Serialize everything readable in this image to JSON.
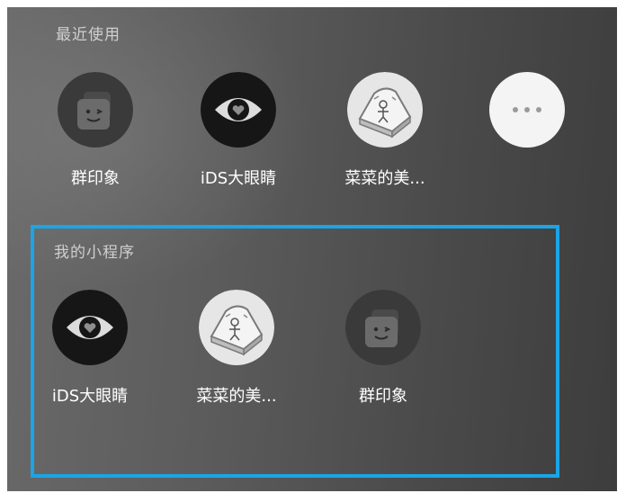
{
  "recent": {
    "title": "最近使用",
    "apps": [
      {
        "label": "群印象",
        "icon": "cube-face-icon"
      },
      {
        "label": "iDS大眼睛",
        "icon": "eye-icon"
      },
      {
        "label": "菜菜的美...",
        "icon": "bread-icon"
      }
    ],
    "more_icon": "more-dots-icon"
  },
  "my_programs": {
    "title": "我的小程序",
    "apps": [
      {
        "label": "iDS大眼睛",
        "icon": "eye-icon"
      },
      {
        "label": "菜菜的美...",
        "icon": "bread-icon"
      },
      {
        "label": "群印象",
        "icon": "cube-face-icon"
      }
    ]
  },
  "colors": {
    "highlight_border": "#1aa5e6",
    "panel_background": "#5a5a5a",
    "label_text": "#ffffff",
    "section_title_text": "#cfcfcf"
  }
}
